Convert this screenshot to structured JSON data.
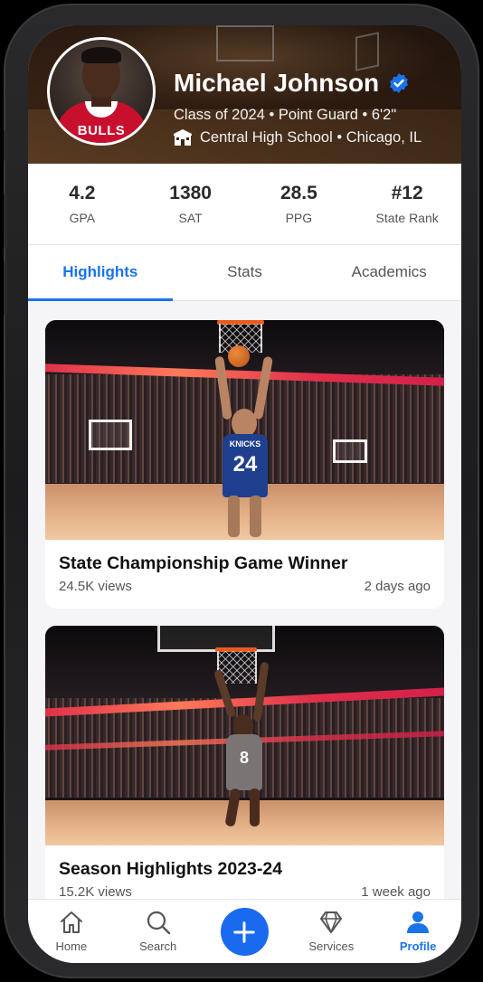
{
  "profile": {
    "name": "Michael Johnson",
    "jersey_text": "BULLS",
    "meta_line": "Class of 2024 • Point Guard • 6'2\"",
    "school_line": "Central High School • Chicago, IL"
  },
  "stats": [
    {
      "value": "4.2",
      "label": "GPA"
    },
    {
      "value": "1380",
      "label": "SAT"
    },
    {
      "value": "28.5",
      "label": "PPG"
    },
    {
      "value": "#12",
      "label": "State Rank"
    }
  ],
  "tabs": [
    {
      "label": "Highlights",
      "active": true
    },
    {
      "label": "Stats",
      "active": false
    },
    {
      "label": "Academics",
      "active": false
    }
  ],
  "feed": [
    {
      "title": "State Championship Game Winner",
      "views": "24.5K views",
      "time": "2 days ago",
      "jersey_number": "24",
      "jersey_team": "KNICKS"
    },
    {
      "title": "Season Highlights 2023-24",
      "views": "15.2K views",
      "time": "1 week ago",
      "jersey_number": "8"
    }
  ],
  "nav": [
    {
      "label": "Home",
      "icon": "home-icon"
    },
    {
      "label": "Search",
      "icon": "search-icon"
    },
    {
      "label": "",
      "icon": "plus-icon"
    },
    {
      "label": "Services",
      "icon": "diamond-icon"
    },
    {
      "label": "Profile",
      "icon": "person-icon",
      "active": true
    }
  ],
  "colors": {
    "accent": "#1a73e8",
    "fab": "#1a6af0",
    "verified": "#1a73e8"
  }
}
